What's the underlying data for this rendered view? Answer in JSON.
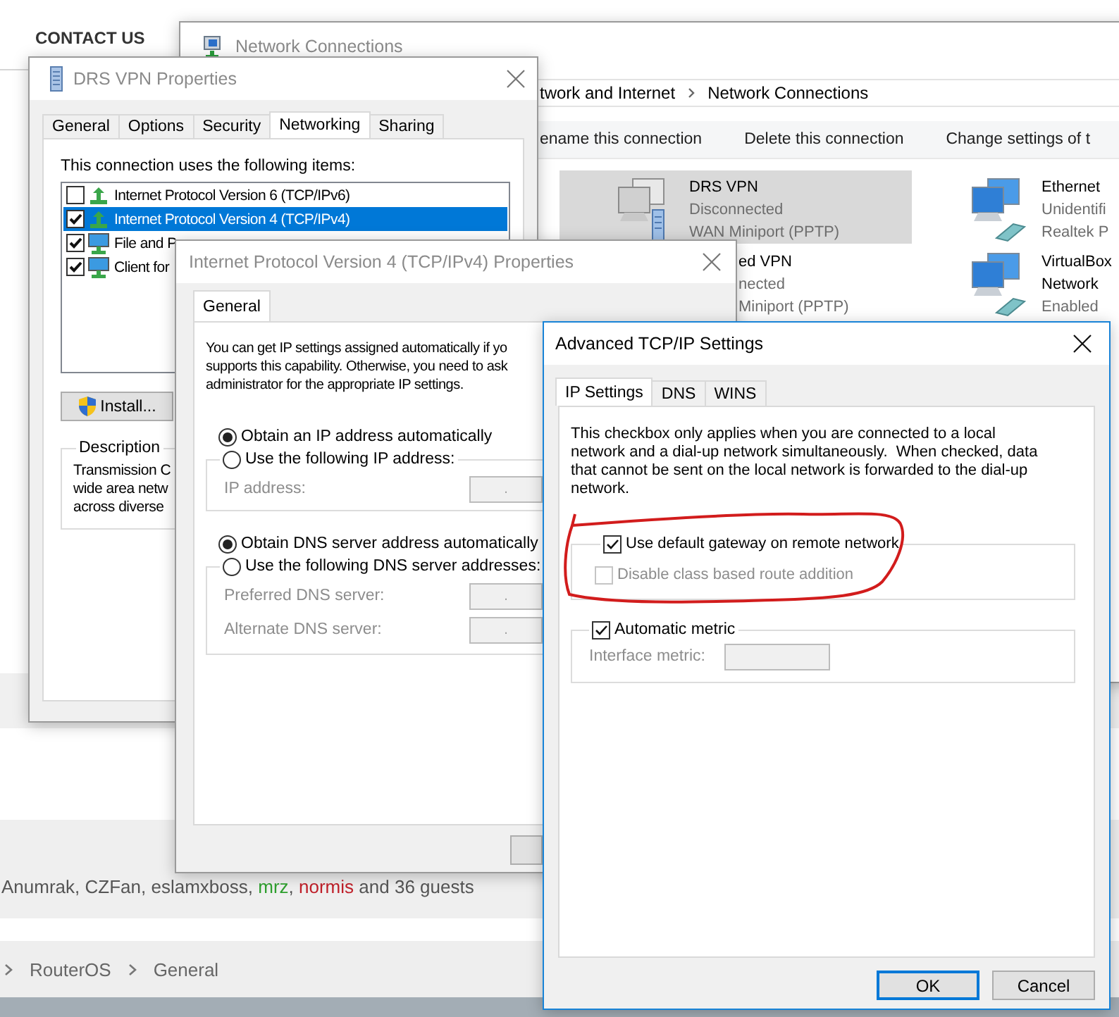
{
  "website": {
    "nav": [
      {
        "label": "CONTACT US"
      }
    ],
    "online_users": {
      "users": [
        {
          "name": "Anumrak",
          "color": "#555555"
        },
        {
          "name": "CZFan",
          "color": "#555555"
        },
        {
          "name": "eslamxboss",
          "color": "#555555"
        },
        {
          "name": "mrz",
          "color": "#2ea02e"
        },
        {
          "name": "normis",
          "color": "#c0202a"
        }
      ],
      "separator": ", ",
      "suffix": "and 36 guests"
    },
    "breadcrumb": [
      "RouterOS",
      "General"
    ]
  },
  "network_connections": {
    "title": "Network Connections",
    "address": [
      "twork and Internet",
      "Network Connections"
    ],
    "commands": [
      "ename this connection",
      "Delete this connection",
      "Change settings of t"
    ],
    "connections": [
      {
        "name_lines": [
          "DRS VPN"
        ],
        "details": [
          "Disconnected",
          "WAN Miniport (PPTP)"
        ],
        "selected": true,
        "kind": "vpn"
      },
      {
        "name_lines": [
          "Ethernet"
        ],
        "details": [
          "Unidentifi",
          "Realtek P"
        ],
        "selected": false,
        "kind": "ethernet"
      },
      {
        "name_lines": [
          "ed VPN"
        ],
        "details": [
          "nected",
          "Miniport (PPTP)"
        ],
        "selected": false,
        "kind": "text_only"
      },
      {
        "name_lines": [
          "VirtualBox",
          "Network"
        ],
        "details": [
          "Enabled"
        ],
        "selected": false,
        "kind": "ethernet"
      }
    ]
  },
  "drs_properties": {
    "title": "DRS VPN Properties",
    "tabs": [
      {
        "label": "General",
        "selected": false
      },
      {
        "label": "Options",
        "selected": false
      },
      {
        "label": "Security",
        "selected": false
      },
      {
        "label": "Networking",
        "selected": true
      },
      {
        "label": "Sharing",
        "selected": false
      }
    ],
    "items_label": "This connection uses the following items:",
    "items": [
      {
        "label": "Internet Protocol Version 6 (TCP/IPv6)",
        "checked": false,
        "selected": false,
        "kind": "protocol"
      },
      {
        "label": "Internet Protocol Version 4 (TCP/IPv4)",
        "checked": true,
        "selected": true,
        "kind": "protocol"
      },
      {
        "label": "File and P",
        "checked": true,
        "selected": false,
        "kind": "service"
      },
      {
        "label": "Client for",
        "checked": true,
        "selected": false,
        "kind": "service"
      }
    ],
    "install_button": "Install...",
    "description": {
      "legend": "Description",
      "lines": [
        "Transmission C",
        "wide area netw",
        "across diverse"
      ]
    }
  },
  "ipv4_properties": {
    "title": "Internet Protocol Version 4 (TCP/IPv4) Properties",
    "tabs": [
      {
        "label": "General",
        "selected": true
      }
    ],
    "intro": [
      "You can get IP settings assigned automatically if yo",
      "supports this capability. Otherwise, you need to ask",
      "administrator for the appropriate IP settings."
    ],
    "ip_mode": [
      {
        "label": "Obtain an IP address automatically",
        "selected": true
      },
      {
        "label": "Use the following IP address:",
        "selected": false
      }
    ],
    "ip_fields": [
      {
        "label": "IP address:",
        "value": ".",
        "disabled": true
      }
    ],
    "dns_mode": [
      {
        "label": "Obtain DNS server address automatically",
        "selected": true
      },
      {
        "label": "Use the following DNS server addresses:",
        "selected": false
      }
    ],
    "dns_fields": [
      {
        "label": "Preferred DNS server:",
        "value": ".",
        "disabled": true
      },
      {
        "label": "Alternate DNS server:",
        "value": ".",
        "disabled": true
      }
    ]
  },
  "advanced_tcpip": {
    "title": "Advanced TCP/IP Settings",
    "tabs": [
      {
        "label": "IP Settings",
        "selected": true
      },
      {
        "label": "DNS",
        "selected": false
      },
      {
        "label": "WINS",
        "selected": false
      }
    ],
    "note_lines": [
      "This checkbox only applies when you are connected to a local",
      "network and a dial-up network simultaneously.  When checked, data",
      "that cannot be sent on the local network is forwarded to the dial-up",
      "network."
    ],
    "gateway": {
      "label": "Use default gateway on remote network",
      "checked": true
    },
    "class_route": {
      "label": "Disable class based route addition",
      "checked": false,
      "disabled": true
    },
    "automatic_metric": {
      "label": "Automatic metric",
      "checked": true
    },
    "interface_metric": {
      "label": "Interface metric:",
      "disabled": true
    },
    "buttons": [
      {
        "label": "OK",
        "default": true
      },
      {
        "label": "Cancel",
        "default": false
      }
    ]
  }
}
